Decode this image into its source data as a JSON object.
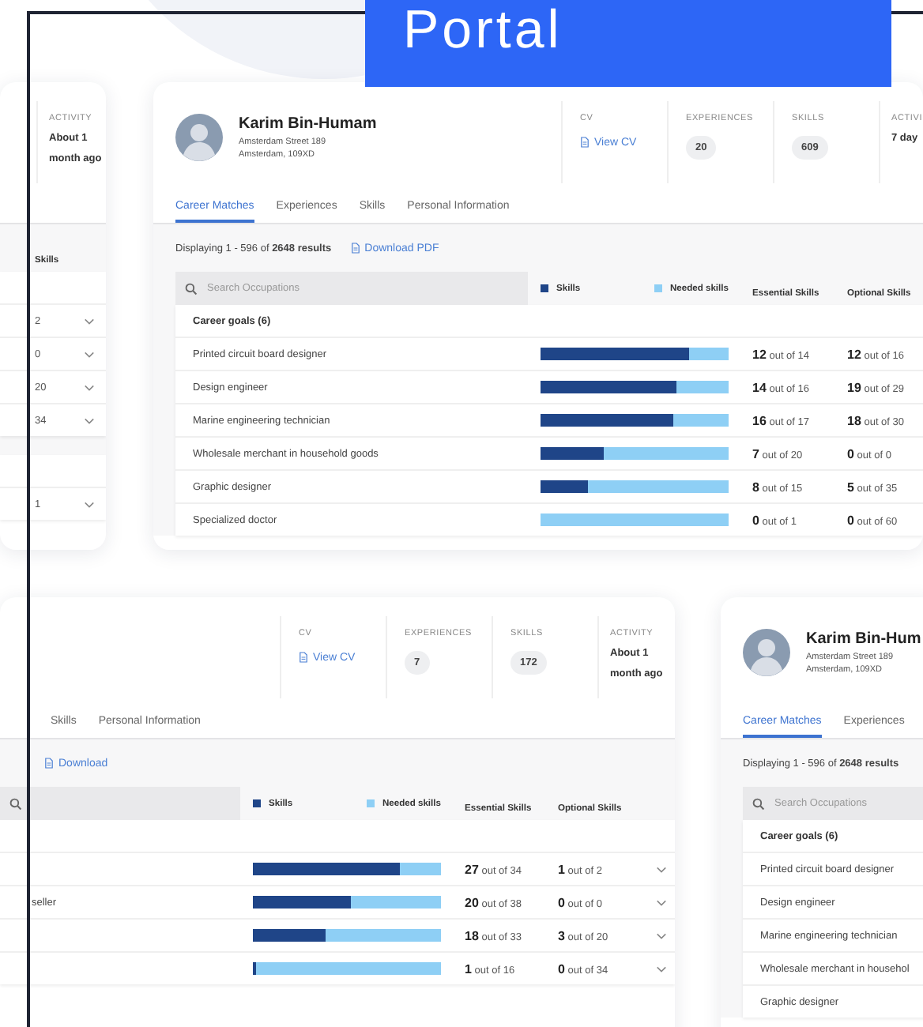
{
  "banner": {
    "title": "Portal"
  },
  "cards": [
    {
      "kind": "left",
      "stats": [
        {
          "kind": "text",
          "label": "ACTIVITY",
          "value": "About 1 month ago"
        }
      ],
      "headers": {
        "optional": "Skills"
      },
      "groups": [
        {
          "rows": [
            {
              "optional": "2"
            },
            {
              "optional": "0"
            },
            {
              "optional": "20"
            },
            {
              "optional": "34"
            }
          ]
        },
        {
          "rows": [
            {
              "optional": "1"
            }
          ]
        }
      ]
    },
    {
      "kind": "main",
      "profile": {
        "name": "Karim Bin-Humam",
        "address": [
          "Amsterdam Street 189",
          "Amsterdam, 109XD"
        ]
      },
      "stats": [
        {
          "kind": "link",
          "label": "CV",
          "value": "View CV"
        },
        {
          "kind": "pill",
          "label": "EXPERIENCES",
          "value": "20"
        },
        {
          "kind": "pill",
          "label": "SKILLS",
          "value": "609"
        },
        {
          "kind": "text",
          "label": "ACTIVI",
          "value": "7 day"
        }
      ],
      "tabs": [
        {
          "label": "Career Matches",
          "selected": true
        },
        {
          "label": "Experiences",
          "selected": false
        },
        {
          "label": "Skills",
          "selected": false
        },
        {
          "label": "Personal Information",
          "selected": false
        }
      ],
      "results": {
        "text": "Displaying 1 - 596 of **2648 results**",
        "download": "Download PDF"
      },
      "search": {
        "placeholder": "Search Occupations"
      },
      "legend": [
        {
          "kind": "skills",
          "label": "Skills"
        },
        {
          "kind": "needed",
          "label": "Needed skills"
        }
      ],
      "headers": {
        "essential": "Essential Skills",
        "optional": "Optional Skills"
      },
      "groups": [
        {
          "title": "Career goals (6)",
          "rows": [
            {
              "name": "Printed circuit board designer",
              "level": 0.79,
              "essential": "**12** out of 14",
              "optional": "**12** out of 16"
            },
            {
              "name": "Design engineer",
              "level": 0.72,
              "essential": "**14** out of 16",
              "optional": "**19** out of 29"
            },
            {
              "name": "Marine engineering technician",
              "level": 0.71,
              "essential": "**16** out of 17",
              "optional": "**18** out of 30"
            },
            {
              "name": "Wholesale merchant in household goods",
              "level": 0.34,
              "essential": "**7** out of 20",
              "optional": "**0** out of 0"
            },
            {
              "name": "Graphic designer",
              "level": 0.25,
              "essential": "**8** out of 15",
              "optional": "**5** out of 35"
            },
            {
              "name": "Specialized doctor",
              "level": 0,
              "essential": "**0** out of 1",
              "optional": "**0** out of 60"
            }
          ]
        }
      ]
    },
    {
      "kind": "bottom",
      "stats": [
        {
          "kind": "link",
          "label": "CV",
          "value": "View CV"
        },
        {
          "kind": "pill",
          "label": "EXPERIENCES",
          "value": "7"
        },
        {
          "kind": "pill",
          "label": "SKILLS",
          "value": "172"
        },
        {
          "kind": "text",
          "label": "ACTIVITY",
          "value": "About 1 month ago"
        }
      ],
      "tabs": [
        {
          "label": "Skills",
          "selected": false
        },
        {
          "label": "Personal Information",
          "selected": false
        }
      ],
      "results": {
        "download": "Download"
      },
      "legend": [
        {
          "kind": "skills",
          "label": "Skills"
        },
        {
          "kind": "needed",
          "label": "Needed skills"
        }
      ],
      "headers": {
        "essential": "Essential Skills",
        "optional": "Optional Skills"
      },
      "groups": [
        {
          "rows": [
            {
              "level": 0.78,
              "essential": "**27** out of 34",
              "optional": "**1** out of 2"
            },
            {
              "name": "seller",
              "level": 0.52,
              "essential": "**20** out of 38",
              "optional": "**0** out of 0"
            },
            {
              "level": 0.39,
              "essential": "**18** out of 33",
              "optional": "**3** out of 20"
            },
            {
              "level": 0.02,
              "essential": "**1** out of 16",
              "optional": "**0** out of 34"
            }
          ]
        }
      ]
    },
    {
      "kind": "side",
      "profile": {
        "name": "Karim Bin-Hum",
        "address": [
          "Amsterdam Street 189",
          "Amsterdam, 109XD"
        ]
      },
      "tabs": [
        {
          "label": "Career Matches",
          "selected": true
        },
        {
          "label": "Experiences",
          "selected": false
        }
      ],
      "results": {
        "text": "Displaying 1 - 596 of **2648 results**"
      },
      "search": {
        "placeholder": "Search Occupations"
      },
      "groups": [
        {
          "title": "Career goals (6)",
          "rows": [
            {
              "name": "Printed circuit board designer"
            },
            {
              "name": "Design engineer"
            },
            {
              "name": "Marine engineering technician"
            },
            {
              "name": "Wholesale merchant in househol"
            },
            {
              "name": "Graphic designer"
            }
          ]
        }
      ]
    }
  ]
}
